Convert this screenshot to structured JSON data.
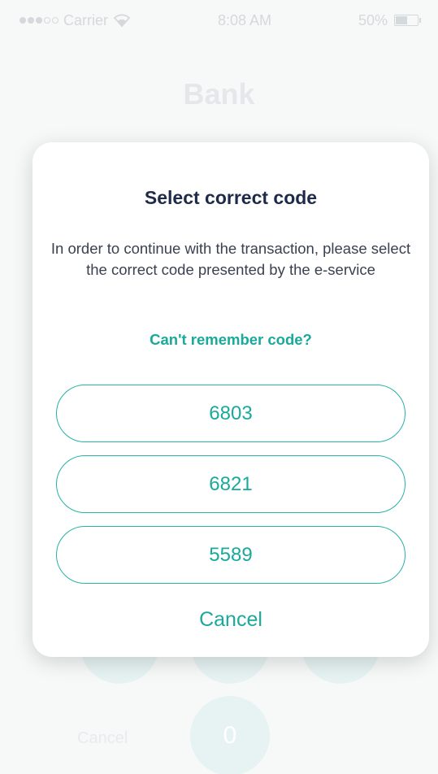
{
  "status_bar": {
    "carrier": "Carrier",
    "time": "8:08 AM",
    "battery": "50%",
    "battery_level": 0.5,
    "wifi_icon": "wifi-icon",
    "signal_icon": "signal-dots-icon"
  },
  "background": {
    "title": "Bank",
    "keypad": {
      "zero": "0",
      "cancel": "Cancel"
    }
  },
  "modal": {
    "title": "Select correct code",
    "message": "In order to continue with the transaction, please select the correct code presented by the e-service",
    "help_link": "Can't remember code?",
    "codes": [
      "6803",
      "6821",
      "5589"
    ],
    "cancel": "Cancel"
  },
  "colors": {
    "accent": "#1aa99b",
    "title": "#1d2a4a",
    "keypad": "#e6f3f2"
  }
}
